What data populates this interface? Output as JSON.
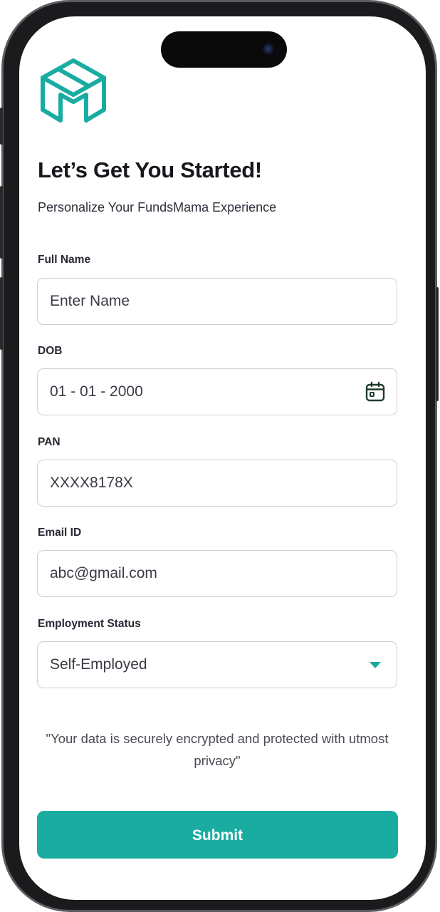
{
  "header": {
    "title": "Let’s Get You Started!",
    "subtitle": "Personalize Your FundsMama Experience"
  },
  "form": {
    "full_name": {
      "label": "Full Name",
      "placeholder": "Enter Name",
      "value": ""
    },
    "dob": {
      "label": "DOB",
      "value": "01 - 01 - 2000",
      "icon": "calendar-icon"
    },
    "pan": {
      "label": "PAN",
      "value": "XXXX8178X"
    },
    "email": {
      "label": "Email ID",
      "value": "abc@gmail.com"
    },
    "employment": {
      "label": "Employment Status",
      "selected": "Self-Employed",
      "icon": "caret-down-icon"
    }
  },
  "privacy_note": "\"Your data is securely encrypted and protected with utmost privacy\"",
  "submit_label": "Submit",
  "colors": {
    "accent": "#1aaca1",
    "calendar_icon": "#1f3d2b",
    "title": "#16161d"
  }
}
